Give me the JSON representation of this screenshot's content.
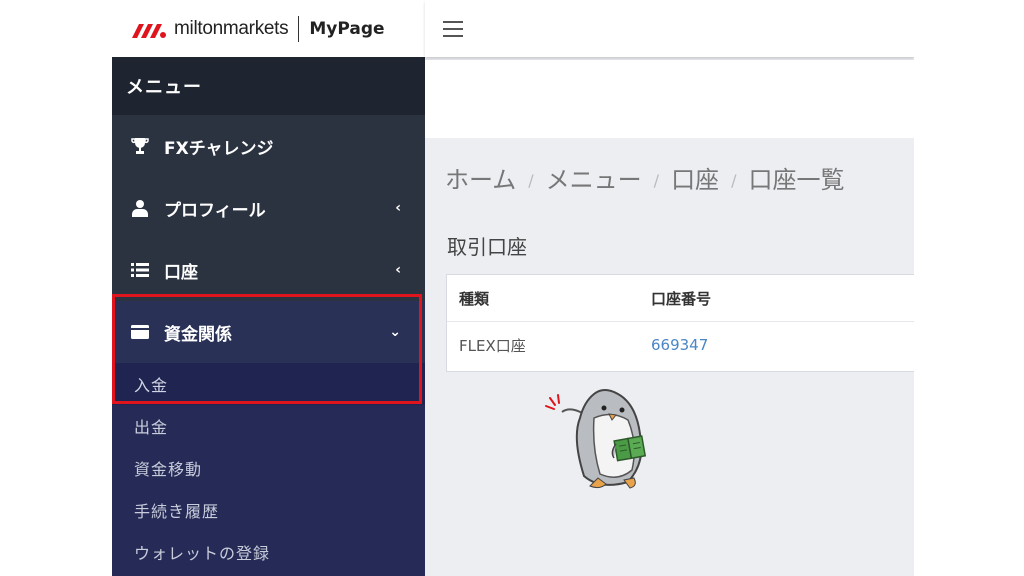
{
  "brand": {
    "logo_light": "milton",
    "logo_bold": "markets",
    "mypage": "MyPage",
    "logo_color": "#e0141c"
  },
  "sidebar": {
    "menu_title": "メニュー",
    "items": [
      {
        "label": "FXチャレンジ",
        "icon": "trophy-icon"
      },
      {
        "label": "プロフィール",
        "icon": "user-icon",
        "chevron": "‹"
      },
      {
        "label": "口座",
        "icon": "list-icon",
        "chevron": "‹"
      },
      {
        "label": "資金関係",
        "icon": "wallet-icon",
        "chevron": "⌄"
      }
    ],
    "subitems": [
      {
        "label": "入金"
      },
      {
        "label": "出金"
      },
      {
        "label": "資金移動"
      },
      {
        "label": "手続き履歴"
      },
      {
        "label": "ウォレットの登録"
      }
    ]
  },
  "breadcrumb": [
    "ホーム",
    "メニュー",
    "口座",
    "口座一覧"
  ],
  "breadcrumb_sep": "/",
  "section_title": "取引口座",
  "table": {
    "headers": [
      "種類",
      "口座番号"
    ],
    "rows": [
      [
        "FLEX口座",
        "669347"
      ]
    ]
  },
  "colors": {
    "sidebar_bg": "#2b3240",
    "active_bg": "#2a3157",
    "highlight": "#e0141c",
    "link": "#4a86c5"
  }
}
